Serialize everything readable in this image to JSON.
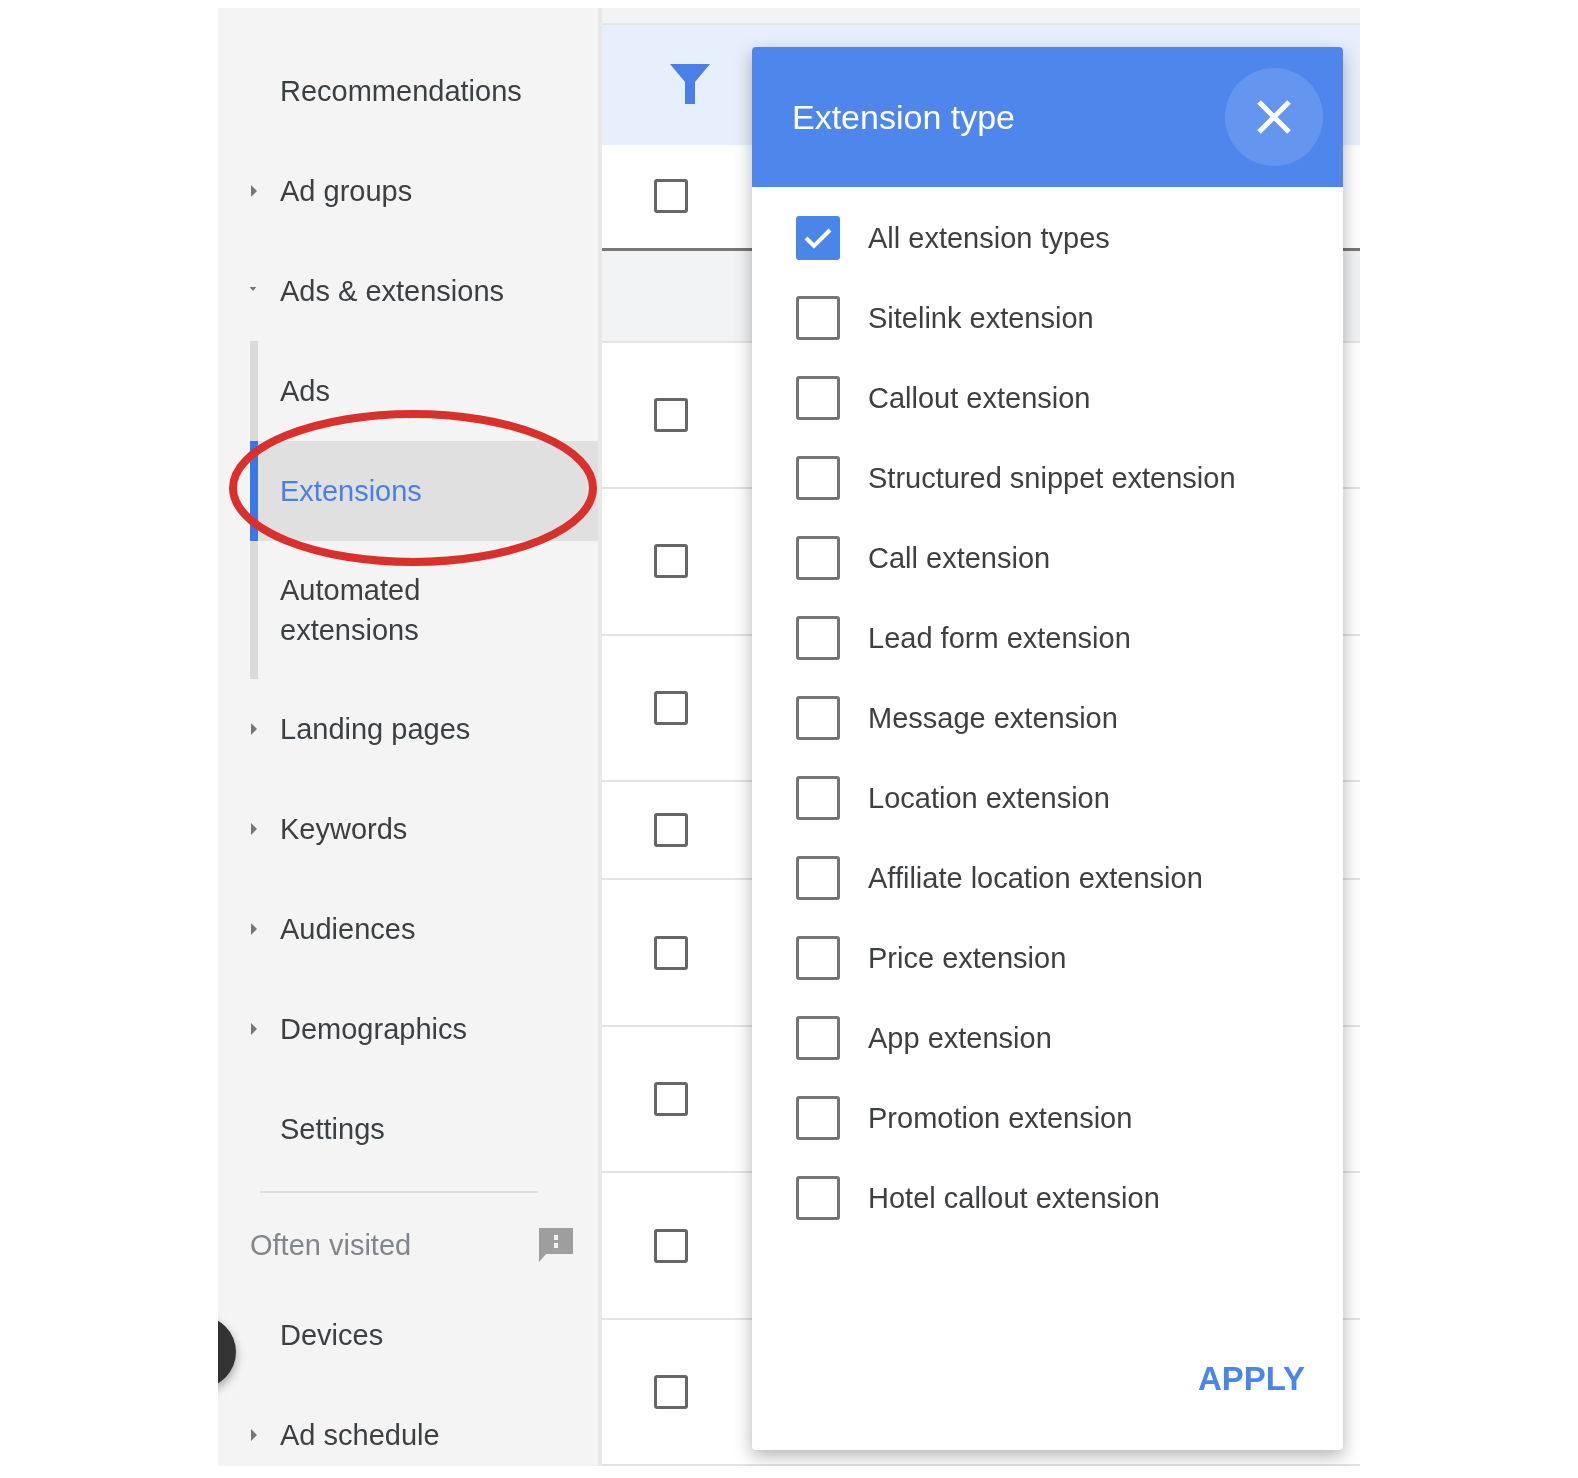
{
  "sidebar": {
    "items": [
      {
        "label": "Recommendations",
        "kind": "link"
      },
      {
        "label": "Ad groups",
        "kind": "group",
        "expanded": false
      },
      {
        "label": "Ads & extensions",
        "kind": "group",
        "expanded": true,
        "children": [
          {
            "label": "Ads",
            "selected": false
          },
          {
            "label": "Extensions",
            "selected": true
          },
          {
            "label": "Automated extensions",
            "selected": false
          }
        ]
      },
      {
        "label": "Landing pages",
        "kind": "group",
        "expanded": false
      },
      {
        "label": "Keywords",
        "kind": "group",
        "expanded": false
      },
      {
        "label": "Audiences",
        "kind": "group",
        "expanded": false
      },
      {
        "label": "Demographics",
        "kind": "group",
        "expanded": false
      },
      {
        "label": "Settings",
        "kind": "link"
      }
    ],
    "section": {
      "title": "Often visited",
      "items": [
        {
          "label": "Devices",
          "kind": "link"
        },
        {
          "label": "Ad schedule",
          "kind": "group",
          "expanded": false
        }
      ]
    }
  },
  "table": {
    "select_all": {
      "checked": false
    },
    "rows": [
      {
        "checked": false
      },
      {
        "checked": false
      },
      {
        "checked": false
      },
      {
        "checked": false
      },
      {
        "checked": false
      },
      {
        "checked": false
      },
      {
        "checked": false
      },
      {
        "checked": false
      }
    ]
  },
  "dialog": {
    "title": "Extension type",
    "options": [
      {
        "label": "All extension types",
        "checked": true
      },
      {
        "label": "Sitelink extension",
        "checked": false
      },
      {
        "label": "Callout extension",
        "checked": false
      },
      {
        "label": "Structured snippet extension",
        "checked": false
      },
      {
        "label": "Call extension",
        "checked": false
      },
      {
        "label": "Lead form extension",
        "checked": false
      },
      {
        "label": "Message extension",
        "checked": false
      },
      {
        "label": "Location extension",
        "checked": false
      },
      {
        "label": "Affiliate location extension",
        "checked": false
      },
      {
        "label": "Price extension",
        "checked": false
      },
      {
        "label": "App extension",
        "checked": false
      },
      {
        "label": "Promotion extension",
        "checked": false
      },
      {
        "label": "Hotel callout extension",
        "checked": false
      }
    ],
    "apply": "APPLY"
  }
}
